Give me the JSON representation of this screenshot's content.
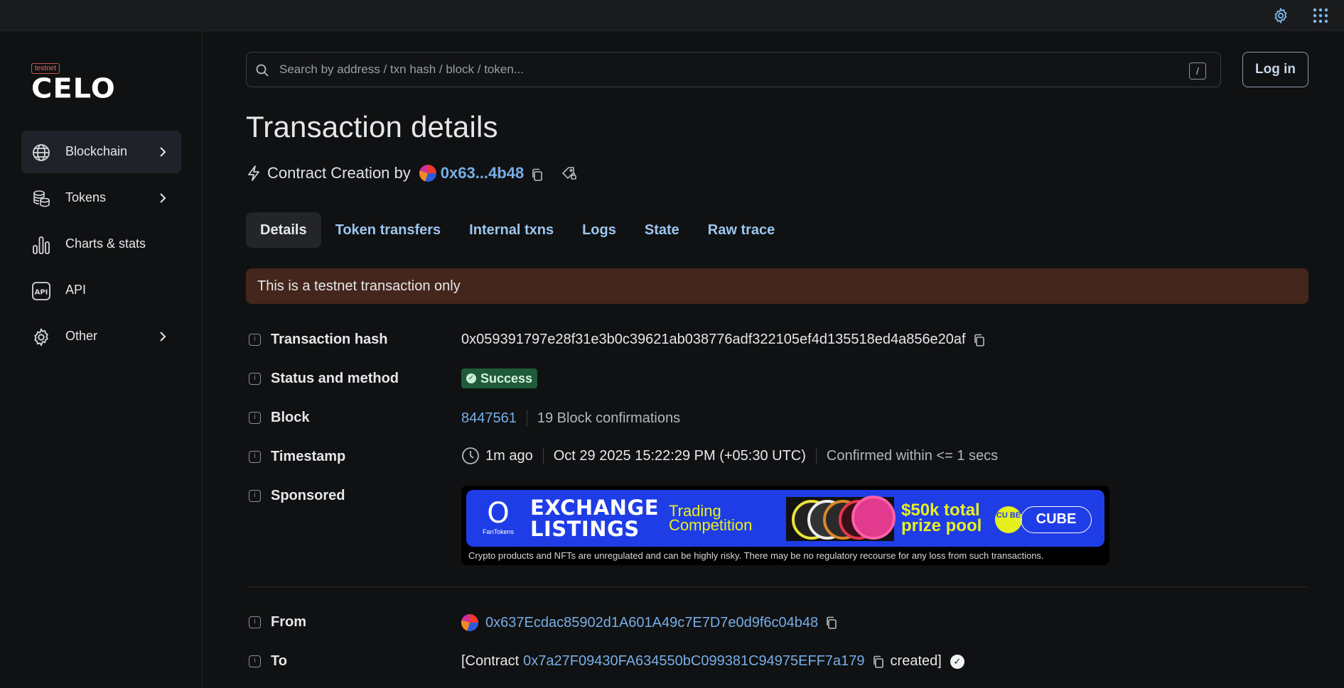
{
  "topbar": {
    "settings_icon": "gear-icon",
    "apps_icon": "grid-icon"
  },
  "sidebar": {
    "badge": "testnet",
    "logo": "CELO",
    "items": [
      {
        "label": "Blockchain",
        "icon": "globe-icon",
        "active": true,
        "chevron": true
      },
      {
        "label": "Tokens",
        "icon": "coins-icon",
        "active": false,
        "chevron": true
      },
      {
        "label": "Charts & stats",
        "icon": "bar-chart-icon",
        "active": false,
        "chevron": false
      },
      {
        "label": "API",
        "icon": "api-icon",
        "active": false,
        "chevron": false
      },
      {
        "label": "Other",
        "icon": "gear-icon",
        "active": false,
        "chevron": true
      }
    ]
  },
  "search": {
    "placeholder": "Search by address / txn hash / block / token...",
    "value": "",
    "shortcut": "/"
  },
  "login": {
    "label": "Log in"
  },
  "page": {
    "title": "Transaction details",
    "subtitle_prefix": "Contract Creation by",
    "subtitle_address": "0x63...4b48"
  },
  "tabs": [
    "Details",
    "Token transfers",
    "Internal txns",
    "Logs",
    "State",
    "Raw trace"
  ],
  "alert": "This is a testnet transaction only",
  "details": {
    "hash_label": "Transaction hash",
    "hash_value": "0x059391797e28f31e3b0c39621ab038776adf322105ef4d135518ed4a856e20af",
    "status_label": "Status and method",
    "status_value": "Success",
    "block_label": "Block",
    "block_value": "8447561",
    "block_confirmations": "19 Block confirmations",
    "timestamp_label": "Timestamp",
    "timestamp_ago": "1m ago",
    "timestamp_date": "Oct 29 2025 15:22:29 PM (+05:30 UTC)",
    "timestamp_confirmed": "Confirmed within <= 1 secs",
    "sponsored_label": "Sponsored",
    "from_label": "From",
    "from_value": "0x637Ecdac85902d1A601A49c7E7D7e0d9f6c04b48",
    "to_label": "To",
    "to_prefix": "[Contract",
    "to_value": "0x7a27F09430FA634550bC099381C94975EFF7a179",
    "to_suffix": "created]"
  },
  "banner": {
    "brand": "FanTokens",
    "headline_1": "EXCHANGE",
    "headline_2": "LISTINGS",
    "tag_1": "Trading",
    "tag_2": "Competition",
    "prize_1": "$50k total",
    "prize_2": "prize pool",
    "cube_mark": "CU BE",
    "cube_button": "CUBE",
    "disclaimer": "Crypto products and NFTs are unregulated and can be highly risky. There may be no regulatory recourse for any loss from such transactions.",
    "colors": {
      "background": "#1f3de6",
      "accent": "#e8f020"
    }
  },
  "colors": {
    "link": "#77aee8",
    "success": "#1f5a3a",
    "alert_bg": "#44261c"
  }
}
